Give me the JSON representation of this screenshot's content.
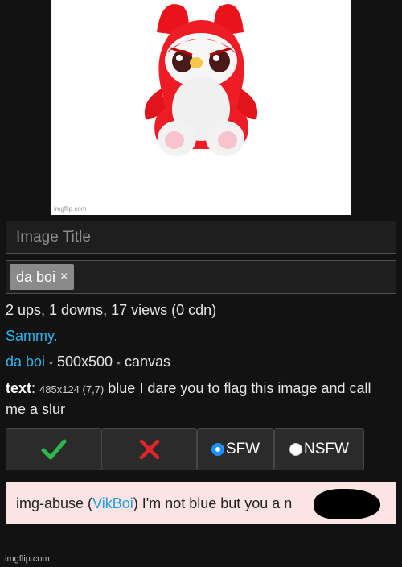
{
  "image": {
    "watermark": "imgflip.com"
  },
  "form": {
    "title_placeholder": "Image Title",
    "tags": [
      {
        "label": "da boi",
        "remove": "×"
      }
    ]
  },
  "stats": "2 ups, 1 downs, 17 views (0 cdn)",
  "author": "Sammy.",
  "meta": {
    "template": "da boi",
    "dimensions": "500x500",
    "type": "canvas"
  },
  "text_box": {
    "label": "text",
    "dims": "485x124 (7,7)",
    "content": "blue I dare you to flag this image and call me a slur"
  },
  "buttons": {
    "sfw": "SFW",
    "nsfw": "NSFW",
    "selected": "SFW"
  },
  "colors": {
    "approve": "#2db84d",
    "reject": "#e3242b",
    "link": "#2fb3e8"
  },
  "abuse": {
    "prefix": "img-abuse (",
    "user": "VikBoi",
    "message": ") I'm not blue but you a n"
  },
  "footer_watermark": "imgflip.com"
}
